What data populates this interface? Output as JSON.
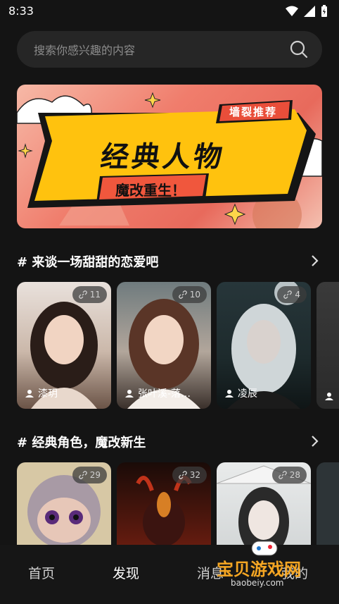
{
  "status_bar": {
    "time": "8:33"
  },
  "search": {
    "placeholder": "搜索你感兴趣的内容"
  },
  "banner": {
    "sticker": "墙裂推荐",
    "title": "经典人物",
    "subtitle": "魔改重生！"
  },
  "sections": [
    {
      "title": "# 来谈一场甜甜的恋爱吧",
      "cards": [
        {
          "name": "漆玥",
          "count": "11"
        },
        {
          "name": "张叶溪-落…",
          "count": "10"
        },
        {
          "name": "凌辰",
          "count": "4"
        },
        {
          "name": "",
          "count": ""
        }
      ]
    },
    {
      "title": "# 经典角色，魔改新生",
      "cards": [
        {
          "name": "",
          "count": "29"
        },
        {
          "name": "",
          "count": "32"
        },
        {
          "name": "",
          "count": "28"
        },
        {
          "name": "",
          "count": ""
        }
      ]
    }
  ],
  "tabbar": {
    "home": "首页",
    "discover": "发现",
    "messages": "消息",
    "mine": "我的"
  },
  "watermark": {
    "text": "宝贝游戏网",
    "url": "baobeiy.com"
  }
}
